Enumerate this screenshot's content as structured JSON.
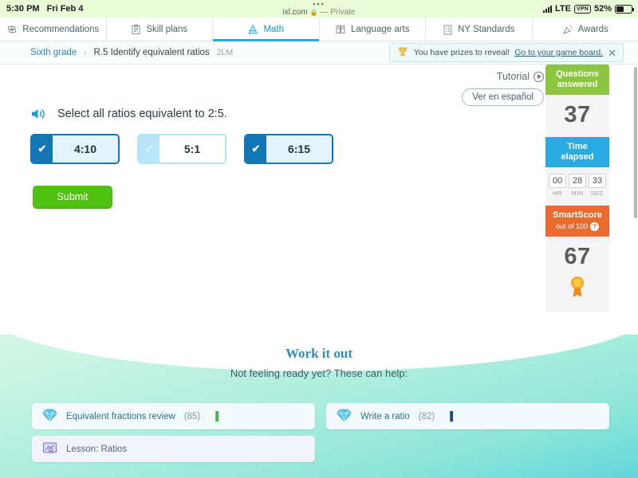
{
  "status_bar": {
    "time": "5:30 PM",
    "date": "Fri Feb 4",
    "url": "ixl.com",
    "lock_icon": "lock-icon",
    "privacy_label": "— Private",
    "network": "LTE",
    "vpn": "VPN",
    "battery_percent": "52%"
  },
  "nav_tabs": [
    {
      "label": "Recommendations",
      "icon": "signpost-icon",
      "active": false
    },
    {
      "label": "Skill plans",
      "icon": "clipboard-icon",
      "active": false
    },
    {
      "label": "Math",
      "icon": "compass-icon",
      "active": true
    },
    {
      "label": "Language arts",
      "icon": "book-icon",
      "active": false
    },
    {
      "label": "NY Standards",
      "icon": "standards-icon",
      "active": false
    },
    {
      "label": "Awards",
      "icon": "party-popper-icon",
      "active": false
    }
  ],
  "breadcrumb": {
    "grade": "Sixth grade",
    "separator": "›",
    "skill": "R.5 Identify equivalent ratios",
    "code": "2LM"
  },
  "prize_banner": {
    "icon": "trophy-icon",
    "message": "You have prizes to reveal!",
    "link": "Go to your game board.",
    "close": "✕"
  },
  "tutorial": {
    "label": "Tutorial",
    "play_icon": "play-circle-icon",
    "spanish_button": "Ver en español"
  },
  "question": {
    "speaker_icon": "speaker-icon",
    "prompt": "Select all ratios equivalent to 2:5.",
    "choices": [
      {
        "value": "4:10",
        "selected": true,
        "check": "✔"
      },
      {
        "value": "5:1",
        "selected": false,
        "check": "✔"
      },
      {
        "value": "6:15",
        "selected": true,
        "check": "✔"
      }
    ],
    "submit_label": "Submit"
  },
  "score_panel": {
    "questions_answered": {
      "title_line1": "Questions",
      "title_line2": "answered",
      "value": "37"
    },
    "time_elapsed": {
      "title_line1": "Time",
      "title_line2": "elapsed",
      "hours": "00",
      "minutes": "28",
      "seconds": "33",
      "hours_unit": "HR",
      "minutes_unit": "MIN",
      "seconds_unit": "SEC"
    },
    "smartscore": {
      "title": "SmartScore",
      "subtitle": "out of 100",
      "help_icon": "question-mark-icon",
      "value": "67",
      "badge_icon": "ribbon-award-icon"
    }
  },
  "work_it_out": {
    "heading": "Work it out",
    "subheading": "Not feeling ready yet? These can help:",
    "resources": [
      {
        "icon": "diamond-icon",
        "label": "Equivalent fractions review",
        "count": "(85)",
        "bookmark": "▐",
        "bookmark_color": "#4caf50",
        "type": "skill"
      },
      {
        "icon": "diamond-icon",
        "label": "Write a ratio",
        "count": "(82)",
        "bookmark": "▐",
        "bookmark_color": "#1f4e79",
        "type": "skill"
      },
      {
        "icon": "lesson-icon",
        "label": "Lesson: Ratios",
        "count": "",
        "bookmark": "",
        "bookmark_color": "",
        "type": "lesson"
      }
    ]
  },
  "colors": {
    "accent_blue": "#2aa5dd",
    "selected_blue": "#1277b3",
    "submit_green": "#4fc111",
    "questions_green": "#8cc63e",
    "time_blue": "#29abe2",
    "smartscore_orange": "#ea6a30",
    "status_bg": "#e9fbd7"
  }
}
